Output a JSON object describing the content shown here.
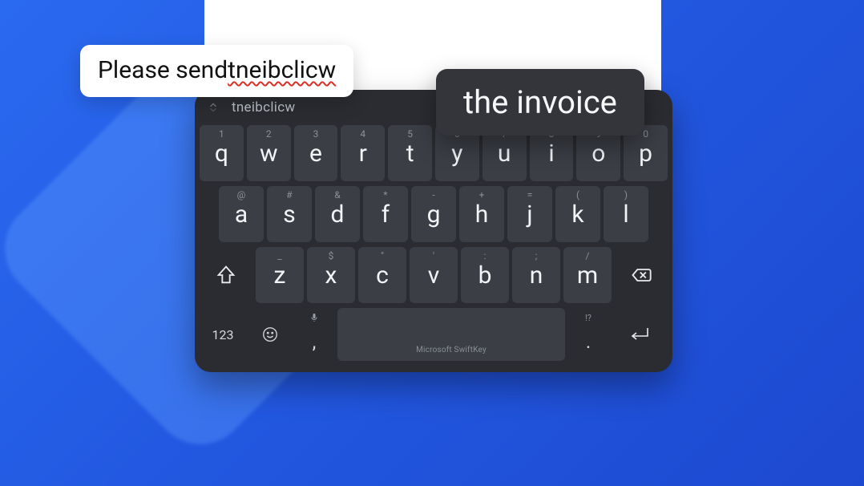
{
  "callouts": {
    "typed_prefix": "Please send ",
    "typed_misspelled": "tneibclicw",
    "suggestion_popup": "the invoice"
  },
  "suggestion_bar": {
    "candidate": "tneibclicw"
  },
  "keys": {
    "row1": [
      {
        "main": "q",
        "hint": "1"
      },
      {
        "main": "w",
        "hint": "2"
      },
      {
        "main": "e",
        "hint": "3"
      },
      {
        "main": "r",
        "hint": "4"
      },
      {
        "main": "t",
        "hint": "5"
      },
      {
        "main": "y",
        "hint": "6"
      },
      {
        "main": "u",
        "hint": "7"
      },
      {
        "main": "i",
        "hint": "8"
      },
      {
        "main": "o",
        "hint": "9"
      },
      {
        "main": "p",
        "hint": "0"
      }
    ],
    "row2": [
      {
        "main": "a",
        "hint": "@"
      },
      {
        "main": "s",
        "hint": "#"
      },
      {
        "main": "d",
        "hint": "&"
      },
      {
        "main": "f",
        "hint": "*"
      },
      {
        "main": "g",
        "hint": "-"
      },
      {
        "main": "h",
        "hint": "+"
      },
      {
        "main": "j",
        "hint": "="
      },
      {
        "main": "k",
        "hint": "("
      },
      {
        "main": "l",
        "hint": ")"
      }
    ],
    "row3": [
      {
        "main": "z",
        "hint": "_"
      },
      {
        "main": "x",
        "hint": "$"
      },
      {
        "main": "c",
        "hint": "\""
      },
      {
        "main": "v",
        "hint": "'"
      },
      {
        "main": "b",
        "hint": ":"
      },
      {
        "main": "n",
        "hint": ";"
      },
      {
        "main": "m",
        "hint": "/"
      }
    ]
  },
  "bottom": {
    "numbers_label": "123",
    "comma": ",",
    "period": ".",
    "period_hint": "!?",
    "space_brand": "Microsoft SwiftKey"
  }
}
